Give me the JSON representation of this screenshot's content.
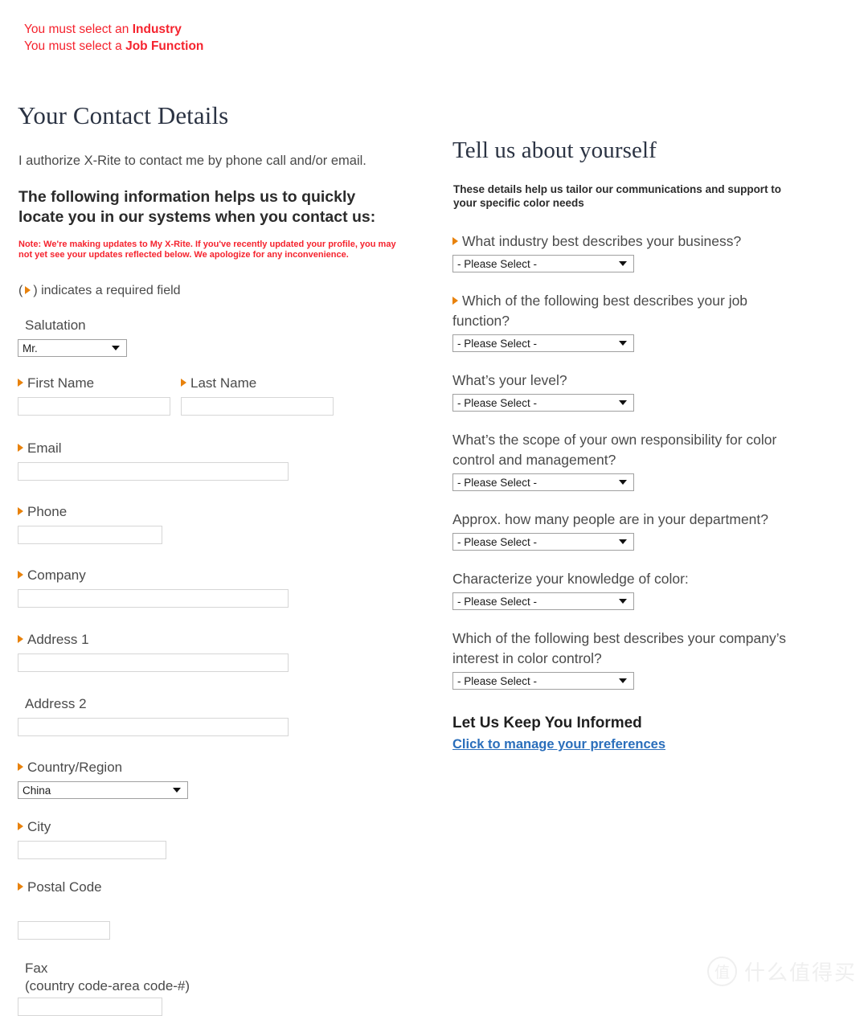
{
  "errors": [
    {
      "prefix": "You must select an ",
      "strong": "Industry"
    },
    {
      "prefix": "You must select a ",
      "strong": "Job Function"
    }
  ],
  "left": {
    "heading": "Your Contact Details",
    "authorize": "I authorize X-Rite to contact me by phone call and/or email.",
    "helps": "The following information helps us to quickly locate you in our systems when you contact us:",
    "note": "Note: We're making updates to My X-Rite. If you've recently updated your profile, you may not yet see your updates reflected below. We apologize for any inconvenience.",
    "required_legend_open": "(",
    "required_legend_close": ") indicates a required field",
    "salutation": {
      "label": "Salutation",
      "value": "Mr.",
      "required": false
    },
    "first_name": {
      "label": "First Name",
      "value": "",
      "required": true
    },
    "last_name": {
      "label": "Last Name",
      "value": "",
      "required": true
    },
    "email": {
      "label": "Email",
      "value": "",
      "required": true
    },
    "phone": {
      "label": "Phone",
      "value": "",
      "required": true
    },
    "company": {
      "label": "Company",
      "value": "",
      "required": true
    },
    "address1": {
      "label": "Address 1",
      "value": "",
      "required": true
    },
    "address2": {
      "label": "Address 2",
      "value": "",
      "required": false
    },
    "country": {
      "label": "Country/Region",
      "value": "China",
      "required": true
    },
    "city": {
      "label": "City",
      "value": "",
      "required": true
    },
    "postal": {
      "label": "Postal Code",
      "value": "",
      "required": true
    },
    "fax": {
      "label_line1": "Fax",
      "label_line2": "(country code-area code-#)",
      "value": "",
      "required": false
    }
  },
  "right": {
    "heading": "Tell us about yourself",
    "subtext": "These details help us tailor our communications and support to your specific color needs",
    "placeholder_select": "- Please Select -",
    "questions": [
      {
        "label": "What industry best describes your business?",
        "value": "- Please Select -",
        "required": true
      },
      {
        "label": "Which of the following best describes your job function?",
        "value": "- Please Select -",
        "required": true
      },
      {
        "label": "What’s your level?",
        "value": "- Please Select -",
        "required": false
      },
      {
        "label": "What’s the scope of your own responsibility for color control and management?",
        "value": "- Please Select -",
        "required": false
      },
      {
        "label": "Approx. how many people are in your department?",
        "value": "- Please Select -",
        "required": false
      },
      {
        "label": "Characterize your knowledge of color:",
        "value": "- Please Select -",
        "required": false
      },
      {
        "label": "Which of the following best describes your company’s interest in color control?",
        "value": "- Please Select -",
        "required": false
      }
    ],
    "informed_heading": "Let Us Keep You Informed",
    "informed_link": "Click to manage your preferences"
  },
  "watermark": {
    "mark": "值",
    "text": "什么值得买"
  },
  "colors": {
    "error_red": "#f5232e",
    "required_orange": "#e8820c",
    "link_blue": "#2a6ebb",
    "heading_navy": "#2b3343"
  }
}
